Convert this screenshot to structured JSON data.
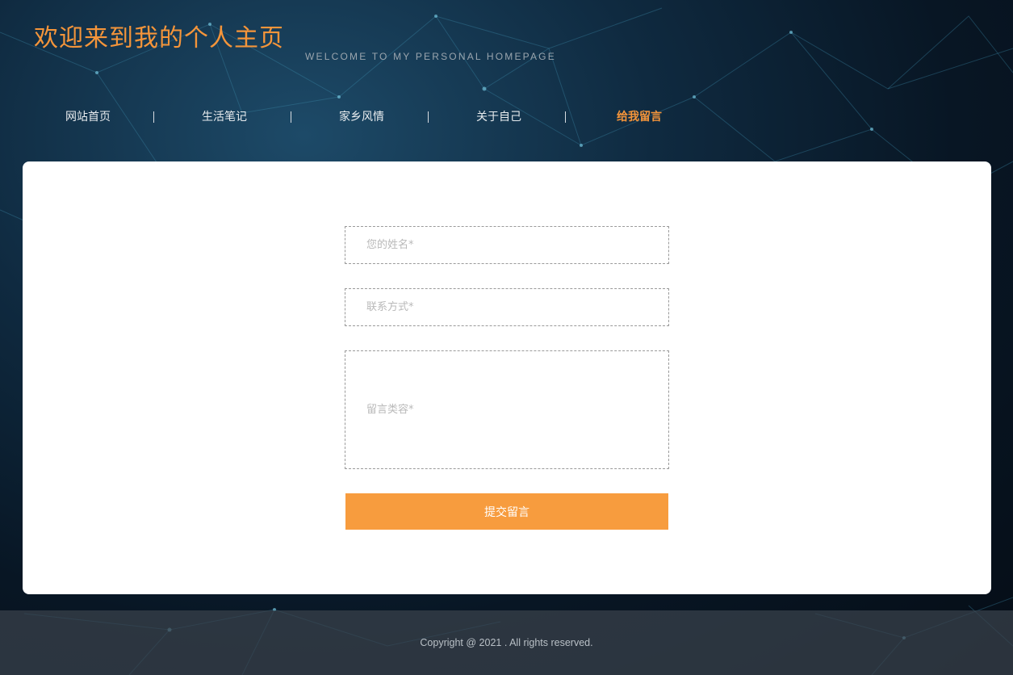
{
  "header": {
    "title": "欢迎来到我的个人主页",
    "subtitle": "WELCOME TO MY PERSONAL HOMEPAGE"
  },
  "nav": {
    "items": [
      {
        "label": "网站首页",
        "active": false
      },
      {
        "label": "生活笔记",
        "active": false
      },
      {
        "label": "家乡风情",
        "active": false
      },
      {
        "label": "关于自己",
        "active": false
      },
      {
        "label": "给我留言",
        "active": true
      }
    ],
    "active_color": "#f5953a"
  },
  "form": {
    "name_placeholder": "您的姓名*",
    "contact_placeholder": "联系方式*",
    "message_placeholder": "留言类容*",
    "submit_label": "提交留言",
    "submit_color": "#f79c3e"
  },
  "footer": {
    "copyright": "Copyright @ 2021 . All rights reserved."
  }
}
